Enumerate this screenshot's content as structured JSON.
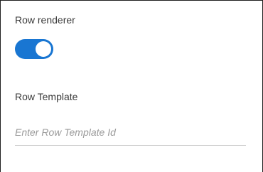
{
  "row_renderer": {
    "label": "Row renderer",
    "toggle_on": true
  },
  "row_template": {
    "label": "Row Template",
    "value": "",
    "placeholder": "Enter Row Template Id"
  },
  "colors": {
    "toggle_on": "#1976d2",
    "knob": "#ffffff",
    "label_text": "#3a3a3a",
    "placeholder_text": "#9a9a9a",
    "underline": "#c8c8c8",
    "border": "#1f1f1f"
  }
}
